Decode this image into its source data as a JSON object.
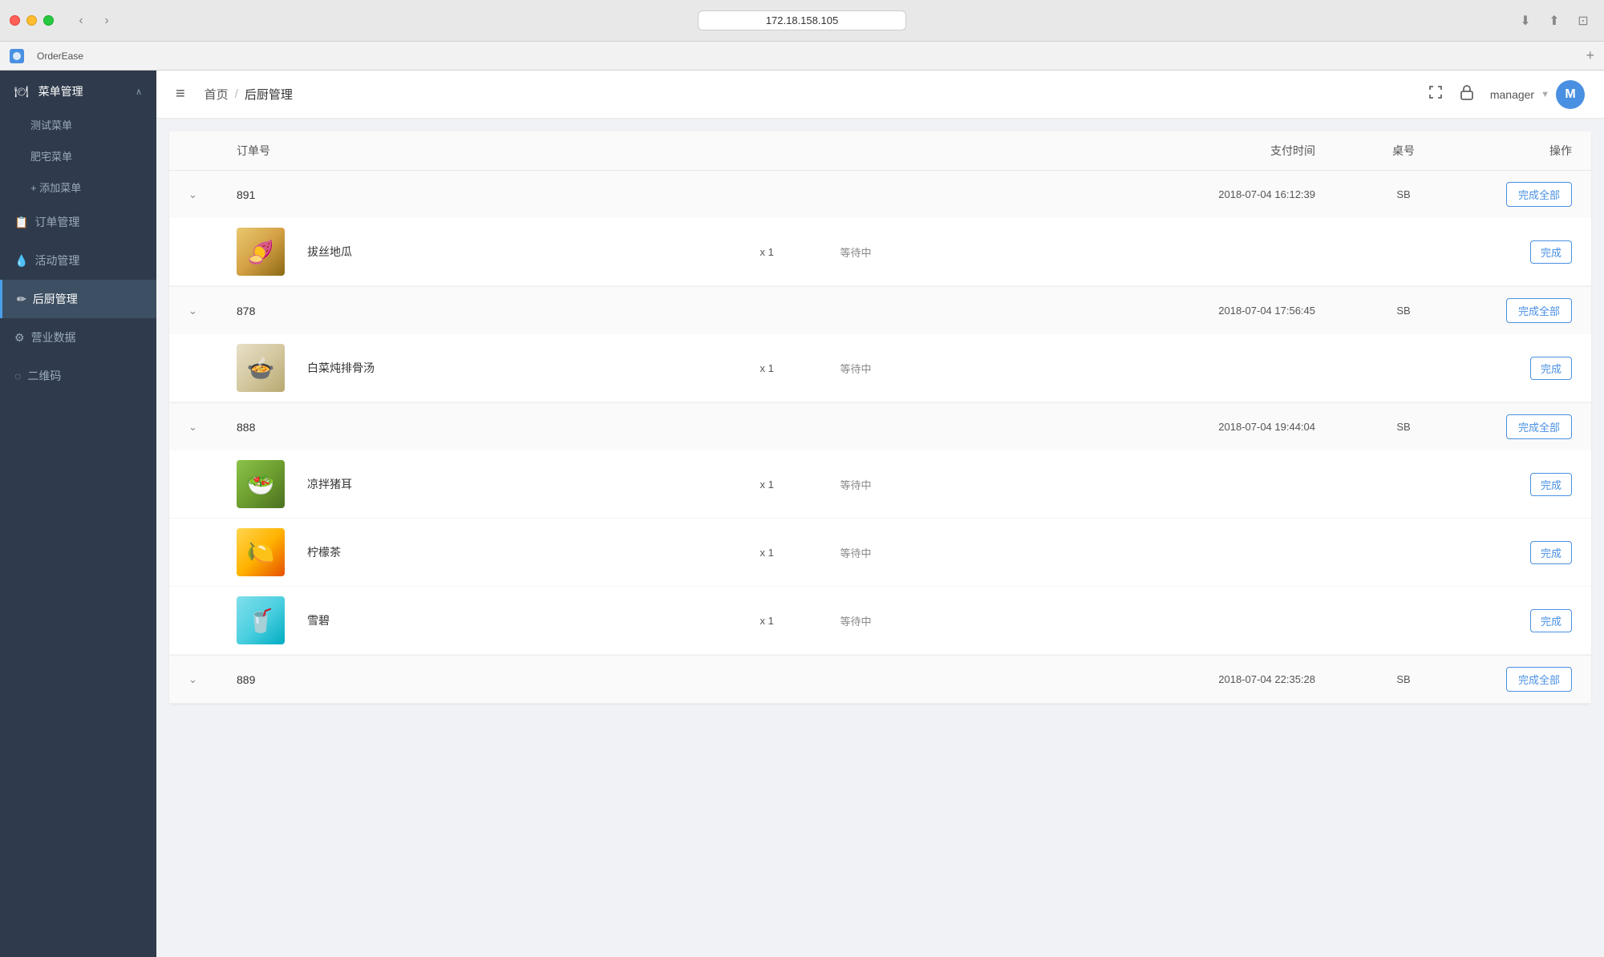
{
  "window": {
    "url": "172.18.158.105",
    "tab_label": "OrderEase",
    "reload_title": "reload"
  },
  "header": {
    "menu_icon": "≡",
    "breadcrumb_home": "首页",
    "breadcrumb_sep": "/",
    "breadcrumb_current": "后厨管理",
    "fullscreen_icon": "⛶",
    "lock_icon": "🔒",
    "user_name": "manager",
    "user_avatar_letter": "M"
  },
  "sidebar": {
    "menu_management": {
      "label": "菜单管理",
      "icon": "🍽",
      "chevron": "∧",
      "sub_items": [
        {
          "label": "测试菜单"
        },
        {
          "label": "肥宅菜单"
        },
        {
          "label": "+ 添加菜单"
        }
      ]
    },
    "order_management": {
      "label": "订单管理",
      "icon": "📋"
    },
    "activity_management": {
      "label": "活动管理",
      "icon": "💧"
    },
    "kitchen_management": {
      "label": "后厨管理",
      "icon": "✏️",
      "active": true
    },
    "business_data": {
      "label": "营业数据",
      "icon": "⚙"
    },
    "qrcode": {
      "label": "二维码",
      "icon": "◌"
    }
  },
  "table": {
    "columns": {
      "order_no": "订单号",
      "pay_time": "支付时间",
      "table_no": "桌号",
      "operations": "操作"
    },
    "orders": [
      {
        "id": "891",
        "pay_time": "2018-07-04 16:12:39",
        "table_no": "SB",
        "complete_all_label": "完成全部",
        "items": [
          {
            "name": "拔丝地瓜",
            "qty": "x 1",
            "status": "等待中",
            "complete_label": "完成",
            "img_class": "food-img-basi",
            "emoji": "🍠"
          }
        ]
      },
      {
        "id": "878",
        "pay_time": "2018-07-04 17:56:45",
        "table_no": "SB",
        "complete_all_label": "完成全部",
        "items": [
          {
            "name": "白菜炖排骨汤",
            "qty": "x 1",
            "status": "等待中",
            "complete_label": "完成",
            "img_class": "food-img-baicai",
            "emoji": "🍲"
          }
        ]
      },
      {
        "id": "888",
        "pay_time": "2018-07-04 19:44:04",
        "table_no": "SB",
        "complete_all_label": "完成全部",
        "items": [
          {
            "name": "凉拌猪耳",
            "qty": "x 1",
            "status": "等待中",
            "complete_label": "完成",
            "img_class": "food-img-liangban",
            "emoji": "🥗"
          },
          {
            "name": "柠檬茶",
            "qty": "x 1",
            "status": "等待中",
            "complete_label": "完成",
            "img_class": "food-img-ningmeng",
            "emoji": "🍋"
          },
          {
            "name": "雪碧",
            "qty": "x 1",
            "status": "等待中",
            "complete_label": "完成",
            "img_class": "food-img-xueb",
            "emoji": "🥤"
          }
        ]
      },
      {
        "id": "889",
        "pay_time": "2018-07-04 22:35:28",
        "table_no": "SB",
        "complete_all_label": "完成全部",
        "items": []
      }
    ]
  }
}
